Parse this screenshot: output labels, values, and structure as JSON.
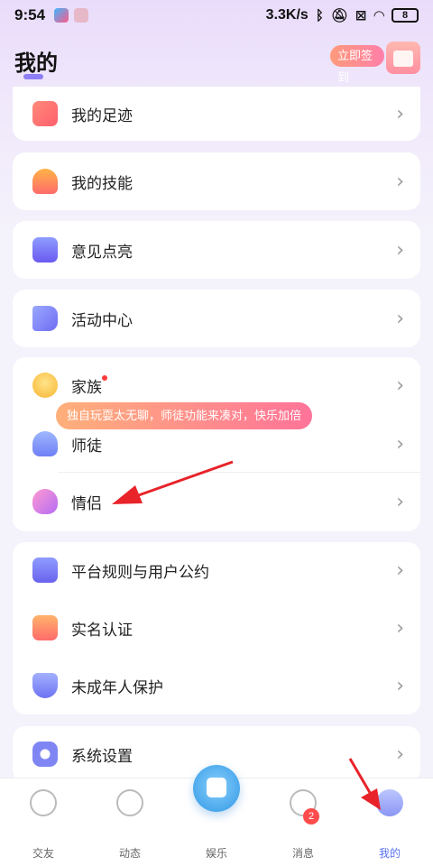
{
  "status": {
    "time": "9:54",
    "network_speed": "3.3K/s",
    "battery": "8"
  },
  "header": {
    "title": "我的",
    "checkin_label": "立即签到"
  },
  "menu": {
    "footprint": "我的足迹",
    "skills": "我的技能",
    "feedback": "意见点亮",
    "activity": "活动中心",
    "family": "家族",
    "mentor": "师徒",
    "couple": "情侣",
    "rules": "平台规则与用户公约",
    "realname": "实名认证",
    "minor": "未成年人保护",
    "settings": "系统设置"
  },
  "tip": "独自玩耍太无聊，师徒功能来凑对，快乐加倍",
  "tabs": {
    "friends": "交友",
    "moments": "动态",
    "entertainment": "娱乐",
    "messages": "消息",
    "messages_badge": "2",
    "mine": "我的"
  },
  "colors": {
    "accent": "#5b73f0",
    "tip_start": "#ffb07a",
    "tip_end": "#ff7399",
    "annotation_arrow": "#e8232a"
  }
}
